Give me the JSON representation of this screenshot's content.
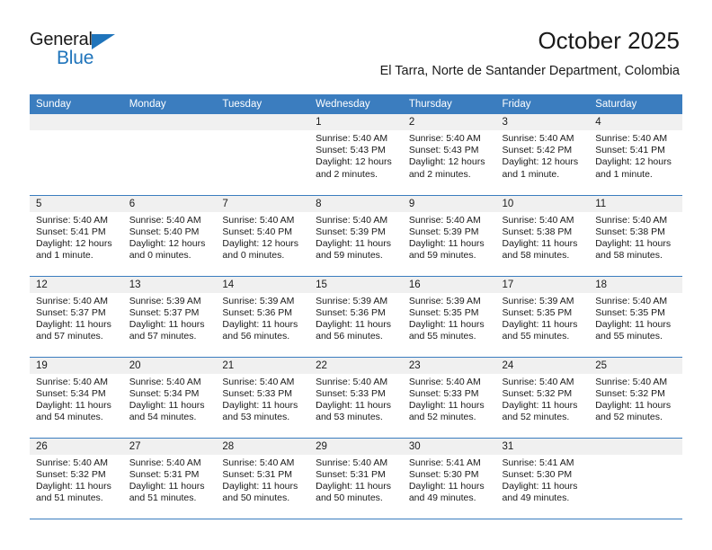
{
  "brand": {
    "name_top": "General",
    "name_bottom": "Blue",
    "triangle_color": "#1f74bb"
  },
  "header": {
    "title": "October 2025",
    "subtitle": "El Tarra, Norte de Santander Department, Colombia"
  },
  "colors": {
    "header_band": "#3b7dbf",
    "daynum_band": "#f0f0f0",
    "text": "#1a1a1a",
    "brand_blue": "#1f74bb"
  },
  "calendar": {
    "weekdays": [
      "Sunday",
      "Monday",
      "Tuesday",
      "Wednesday",
      "Thursday",
      "Friday",
      "Saturday"
    ],
    "weeks": [
      [
        {
          "day": "",
          "empty": true
        },
        {
          "day": "",
          "empty": true
        },
        {
          "day": "",
          "empty": true
        },
        {
          "day": "1",
          "sunrise": "Sunrise: 5:40 AM",
          "sunset": "Sunset: 5:43 PM",
          "daylight": "Daylight: 12 hours and 2 minutes."
        },
        {
          "day": "2",
          "sunrise": "Sunrise: 5:40 AM",
          "sunset": "Sunset: 5:43 PM",
          "daylight": "Daylight: 12 hours and 2 minutes."
        },
        {
          "day": "3",
          "sunrise": "Sunrise: 5:40 AM",
          "sunset": "Sunset: 5:42 PM",
          "daylight": "Daylight: 12 hours and 1 minute."
        },
        {
          "day": "4",
          "sunrise": "Sunrise: 5:40 AM",
          "sunset": "Sunset: 5:41 PM",
          "daylight": "Daylight: 12 hours and 1 minute."
        }
      ],
      [
        {
          "day": "5",
          "sunrise": "Sunrise: 5:40 AM",
          "sunset": "Sunset: 5:41 PM",
          "daylight": "Daylight: 12 hours and 1 minute."
        },
        {
          "day": "6",
          "sunrise": "Sunrise: 5:40 AM",
          "sunset": "Sunset: 5:40 PM",
          "daylight": "Daylight: 12 hours and 0 minutes."
        },
        {
          "day": "7",
          "sunrise": "Sunrise: 5:40 AM",
          "sunset": "Sunset: 5:40 PM",
          "daylight": "Daylight: 12 hours and 0 minutes."
        },
        {
          "day": "8",
          "sunrise": "Sunrise: 5:40 AM",
          "sunset": "Sunset: 5:39 PM",
          "daylight": "Daylight: 11 hours and 59 minutes."
        },
        {
          "day": "9",
          "sunrise": "Sunrise: 5:40 AM",
          "sunset": "Sunset: 5:39 PM",
          "daylight": "Daylight: 11 hours and 59 minutes."
        },
        {
          "day": "10",
          "sunrise": "Sunrise: 5:40 AM",
          "sunset": "Sunset: 5:38 PM",
          "daylight": "Daylight: 11 hours and 58 minutes."
        },
        {
          "day": "11",
          "sunrise": "Sunrise: 5:40 AM",
          "sunset": "Sunset: 5:38 PM",
          "daylight": "Daylight: 11 hours and 58 minutes."
        }
      ],
      [
        {
          "day": "12",
          "sunrise": "Sunrise: 5:40 AM",
          "sunset": "Sunset: 5:37 PM",
          "daylight": "Daylight: 11 hours and 57 minutes."
        },
        {
          "day": "13",
          "sunrise": "Sunrise: 5:39 AM",
          "sunset": "Sunset: 5:37 PM",
          "daylight": "Daylight: 11 hours and 57 minutes."
        },
        {
          "day": "14",
          "sunrise": "Sunrise: 5:39 AM",
          "sunset": "Sunset: 5:36 PM",
          "daylight": "Daylight: 11 hours and 56 minutes."
        },
        {
          "day": "15",
          "sunrise": "Sunrise: 5:39 AM",
          "sunset": "Sunset: 5:36 PM",
          "daylight": "Daylight: 11 hours and 56 minutes."
        },
        {
          "day": "16",
          "sunrise": "Sunrise: 5:39 AM",
          "sunset": "Sunset: 5:35 PM",
          "daylight": "Daylight: 11 hours and 55 minutes."
        },
        {
          "day": "17",
          "sunrise": "Sunrise: 5:39 AM",
          "sunset": "Sunset: 5:35 PM",
          "daylight": "Daylight: 11 hours and 55 minutes."
        },
        {
          "day": "18",
          "sunrise": "Sunrise: 5:40 AM",
          "sunset": "Sunset: 5:35 PM",
          "daylight": "Daylight: 11 hours and 55 minutes."
        }
      ],
      [
        {
          "day": "19",
          "sunrise": "Sunrise: 5:40 AM",
          "sunset": "Sunset: 5:34 PM",
          "daylight": "Daylight: 11 hours and 54 minutes."
        },
        {
          "day": "20",
          "sunrise": "Sunrise: 5:40 AM",
          "sunset": "Sunset: 5:34 PM",
          "daylight": "Daylight: 11 hours and 54 minutes."
        },
        {
          "day": "21",
          "sunrise": "Sunrise: 5:40 AM",
          "sunset": "Sunset: 5:33 PM",
          "daylight": "Daylight: 11 hours and 53 minutes."
        },
        {
          "day": "22",
          "sunrise": "Sunrise: 5:40 AM",
          "sunset": "Sunset: 5:33 PM",
          "daylight": "Daylight: 11 hours and 53 minutes."
        },
        {
          "day": "23",
          "sunrise": "Sunrise: 5:40 AM",
          "sunset": "Sunset: 5:33 PM",
          "daylight": "Daylight: 11 hours and 52 minutes."
        },
        {
          "day": "24",
          "sunrise": "Sunrise: 5:40 AM",
          "sunset": "Sunset: 5:32 PM",
          "daylight": "Daylight: 11 hours and 52 minutes."
        },
        {
          "day": "25",
          "sunrise": "Sunrise: 5:40 AM",
          "sunset": "Sunset: 5:32 PM",
          "daylight": "Daylight: 11 hours and 52 minutes."
        }
      ],
      [
        {
          "day": "26",
          "sunrise": "Sunrise: 5:40 AM",
          "sunset": "Sunset: 5:32 PM",
          "daylight": "Daylight: 11 hours and 51 minutes."
        },
        {
          "day": "27",
          "sunrise": "Sunrise: 5:40 AM",
          "sunset": "Sunset: 5:31 PM",
          "daylight": "Daylight: 11 hours and 51 minutes."
        },
        {
          "day": "28",
          "sunrise": "Sunrise: 5:40 AM",
          "sunset": "Sunset: 5:31 PM",
          "daylight": "Daylight: 11 hours and 50 minutes."
        },
        {
          "day": "29",
          "sunrise": "Sunrise: 5:40 AM",
          "sunset": "Sunset: 5:31 PM",
          "daylight": "Daylight: 11 hours and 50 minutes."
        },
        {
          "day": "30",
          "sunrise": "Sunrise: 5:41 AM",
          "sunset": "Sunset: 5:30 PM",
          "daylight": "Daylight: 11 hours and 49 minutes."
        },
        {
          "day": "31",
          "sunrise": "Sunrise: 5:41 AM",
          "sunset": "Sunset: 5:30 PM",
          "daylight": "Daylight: 11 hours and 49 minutes."
        },
        {
          "day": "",
          "empty": true
        }
      ]
    ]
  }
}
